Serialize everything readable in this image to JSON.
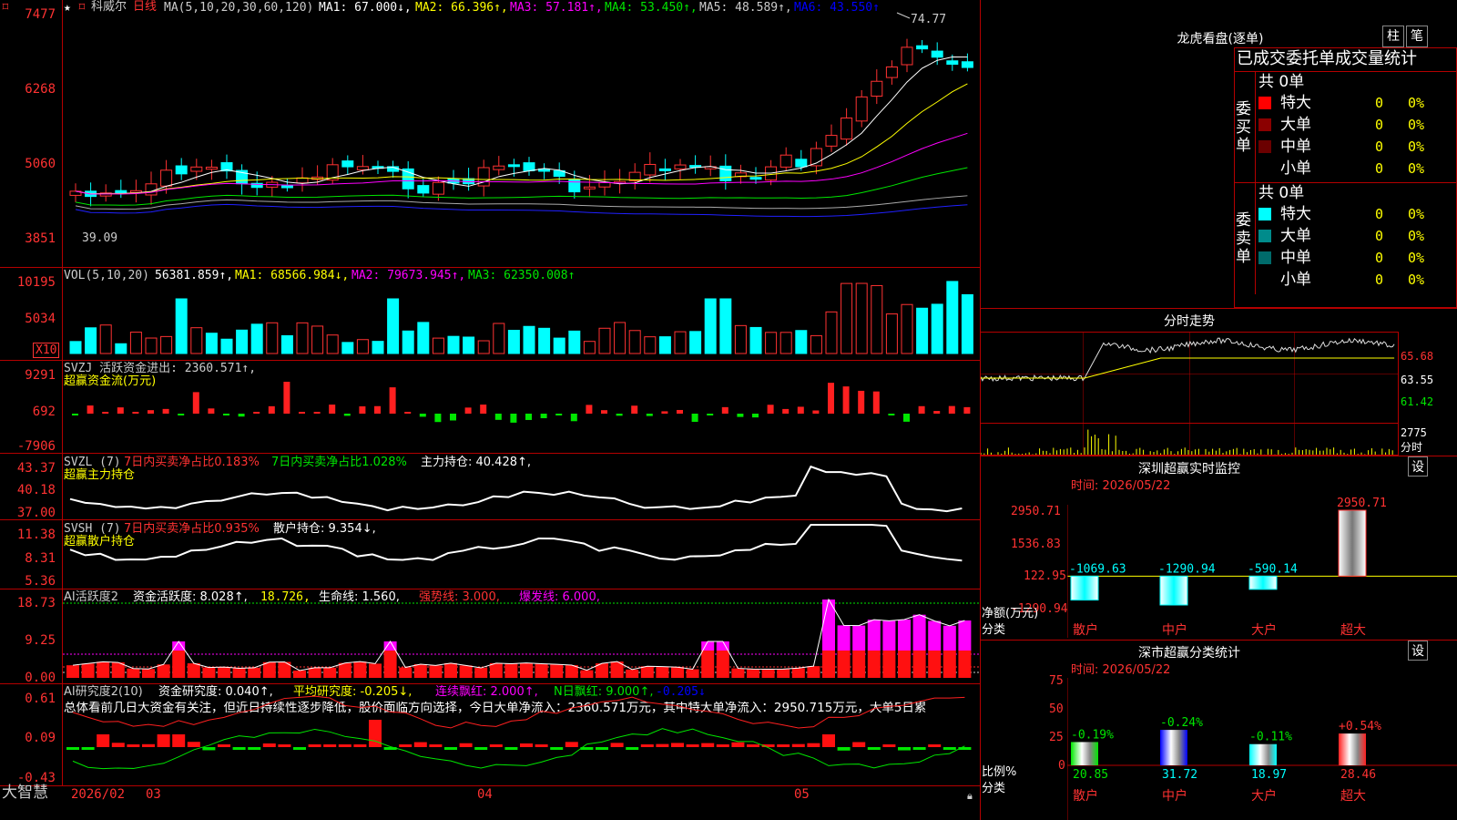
{
  "app_logo": "大智慧",
  "top_bar": {
    "stock_name": "科威尔",
    "period": "日线",
    "ma_label": "MA(5,10,20,30,60,120)",
    "ma1": "MA1: 67.000↓,",
    "ma2": "MA2: 66.396↑,",
    "ma3": "MA3: 57.181↑,",
    "ma4": "MA4: 53.450↑,",
    "ma5": "MA5: 48.589↑,",
    "ma6": "MA6: 43.550↑",
    "high_mark": "74.77",
    "low_mark": "39.09"
  },
  "price_axis": [
    "7477",
    "6268",
    "5060",
    "3851"
  ],
  "vol_panel": {
    "label": "VOL(5,10,20)",
    "v": "56381.859↑,",
    "ma1": "MA1: 68566.984↓,",
    "ma2": "MA2: 79673.945↑,",
    "ma3": "MA3: 62350.008↑",
    "axis": [
      "10195",
      "5034"
    ],
    "unit": "X10"
  },
  "svzj_panel": {
    "label": "SVZJ  活跃资金进出: 2360.571↑,",
    "sub": "超赢资金流(万元)",
    "axis": [
      "9291",
      "692",
      "-7906"
    ]
  },
  "svzl_panel": {
    "label": "SVZL  (7)",
    "a": "7日内买卖净占比0.183%",
    "b": "7日内买卖净占比1.028%",
    "c": "主力持仓: 40.428↑,",
    "sub": "超赢主力持仓",
    "axis": [
      "43.37",
      "40.18",
      "37.00"
    ]
  },
  "svsh_panel": {
    "label": "SVSH  (7)",
    "a": "7日内买卖净占比0.935%",
    "c": "散户持仓: 9.354↓,",
    "sub": "超赢散户持仓",
    "axis": [
      "11.38",
      "8.31",
      "5.36"
    ]
  },
  "ai_active": {
    "label": "AI活跃度2",
    "a": "资金活跃度: 8.028↑,",
    "b": "18.726,",
    "c": "生命线: 1.560,",
    "d": "强势线: 3.000,",
    "e": "爆发线: 6.000,",
    "axis": [
      "18.73",
      "9.25",
      "0.00"
    ]
  },
  "ai_research": {
    "label": "AI研究度2(10)",
    "a": "资金研究度: 0.040↑,",
    "b": "平均研究度: -0.205↓,",
    "c": "连续飘红: 2.000↑,",
    "d": "N日飘红: 9.000↑,",
    "e": "-0.205↓",
    "summary": "总体看前几日大资金有关注，但近日持续性逐步降低，股价面临方向选择，今日大单净流入：2360.571万元，其中特大单净流入：2950.715万元，大单5日累",
    "axis": [
      "0.61",
      "0.09",
      "-0.43"
    ]
  },
  "date_axis": [
    "2026/02",
    "03",
    "04",
    "05"
  ],
  "dragon_tiger": {
    "title": "龙虎看盘(逐单)",
    "btn_bar": "柱",
    "btn_count": "笔",
    "header": "已成交委托单成交量统计",
    "buy_side": "委买单",
    "sell_side": "委卖单",
    "buy_total": "共 0单",
    "sell_total": "共 0单",
    "rows": [
      {
        "label": "特大",
        "count": "0",
        "pct": "0%"
      },
      {
        "label": "大单",
        "count": "0",
        "pct": "0%"
      },
      {
        "label": "中单",
        "count": "0",
        "pct": "0%"
      },
      {
        "label": "小单",
        "count": "0",
        "pct": "0%"
      }
    ],
    "buy_colors": [
      "#ff0000",
      "#8b0000",
      "#6b0000",
      "#000000"
    ],
    "sell_colors": [
      "#00ffff",
      "#008b8b",
      "#006b6b",
      "#000000"
    ]
  },
  "intraday": {
    "title": "分时走势",
    "axis": [
      "65.68",
      "63.55",
      "61.42"
    ],
    "vol_axis": "2775",
    "vol_unit": "分时"
  },
  "sz_monitor": {
    "title": "深圳超赢实时监控",
    "btn": "设",
    "time": "时间: 2026/05/22",
    "axis": [
      "2950.71",
      "1536.83",
      "122.95",
      "-1290.94"
    ],
    "ylabel": "净额(万元)",
    "xlabel": "分类",
    "cats": [
      "散户",
      "中户",
      "大户",
      "超大"
    ],
    "values": [
      -1069.63,
      -1290.94,
      -590.14,
      2950.71
    ],
    "labels": [
      "-1069.63",
      "-1290.94",
      "-590.14",
      "2950.71"
    ]
  },
  "sz_stat": {
    "title": "深市超赢分类统计",
    "btn": "设",
    "time": "时间: 2026/05/22",
    "axis": [
      "75",
      "50",
      "25",
      "0"
    ],
    "ylabel": "比例%",
    "xlabel": "分类",
    "cats": [
      "散户",
      "中户",
      "大户",
      "超大"
    ],
    "values": [
      20.85,
      31.72,
      18.97,
      28.46
    ],
    "labels": [
      "20.85",
      "31.72",
      "18.97",
      "28.46"
    ],
    "changes": [
      "-0.19%",
      "-0.24%",
      "-0.11%",
      "+0.54%"
    ]
  }
}
